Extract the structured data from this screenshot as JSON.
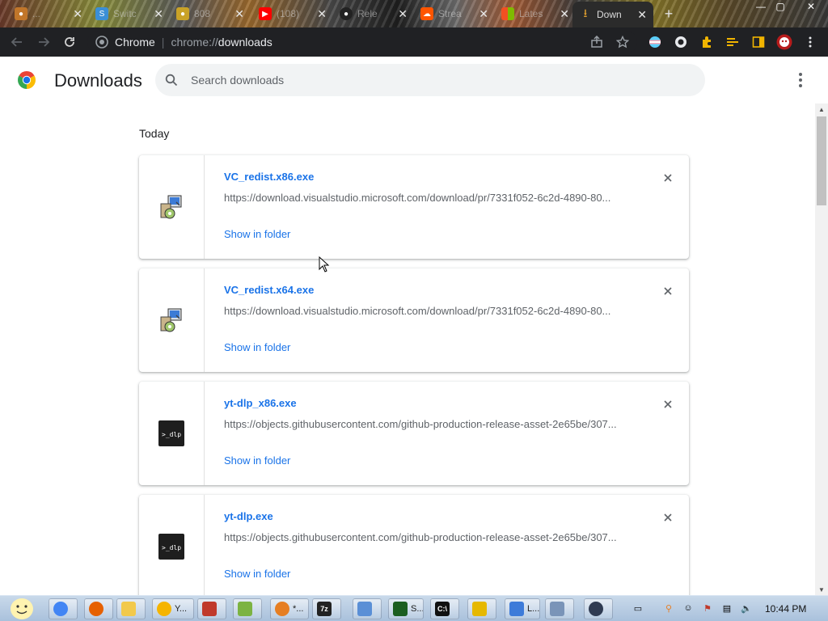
{
  "browser": {
    "tabs": [
      {
        "label": "...",
        "fav_color": "#c1762a"
      },
      {
        "label": "Switc",
        "fav_color": "#3b8fd6"
      },
      {
        "label": "808",
        "fav_color": "#c9a227"
      },
      {
        "label": "(108)",
        "fav_color": "#ff0000"
      },
      {
        "label": "Rele",
        "fav_color": "#222222"
      },
      {
        "label": "Strea",
        "fav_color": "#ff5500"
      },
      {
        "label": "Lates",
        "fav_color": "#0078d4"
      },
      {
        "label": "Down",
        "fav_color": "#e0a030",
        "active": true
      }
    ],
    "window_controls": {
      "minimize": "—",
      "maximize": "▢",
      "close": "✕"
    },
    "omnibox": {
      "site_label": "Chrome",
      "scheme": "chrome://",
      "path": "downloads"
    }
  },
  "page": {
    "title": "Downloads",
    "search_placeholder": "Search downloads",
    "section_label": "Today",
    "remove_label": "Remove from list",
    "items": [
      {
        "filename": "VC_redist.x86.exe",
        "url": "https://download.visualstudio.microsoft.com/download/pr/7331f052-6c2d-4890-80...",
        "action": "Show in folder",
        "icon": "installer-icon"
      },
      {
        "filename": "VC_redist.x64.exe",
        "url": "https://download.visualstudio.microsoft.com/download/pr/7331f052-6c2d-4890-80...",
        "action": "Show in folder",
        "icon": "installer-icon"
      },
      {
        "filename": "yt-dlp_x86.exe",
        "url": "https://objects.githubusercontent.com/github-production-release-asset-2e65be/307...",
        "action": "Show in folder",
        "icon": "yt-dlp-icon",
        "icon_text": ">_dlp"
      },
      {
        "filename": "yt-dlp.exe",
        "url": "https://objects.githubusercontent.com/github-production-release-asset-2e65be/307...",
        "action": "Show in folder",
        "icon": "yt-dlp-icon",
        "icon_text": ">_dlp"
      }
    ]
  },
  "taskbar": {
    "items": [
      {
        "label": "",
        "icon": "chrome-icon",
        "color": "#4285f4"
      },
      {
        "label": "",
        "icon": "firefox-icon",
        "color": "#e66000"
      },
      {
        "label": "",
        "icon": "folder-icon",
        "color": "#f2c94c"
      },
      {
        "label": "Y...",
        "icon": "emoji-icon",
        "color": "#f5b400"
      },
      {
        "label": "",
        "icon": "app-icon",
        "color": "#c0392b"
      },
      {
        "label": "",
        "icon": "notepad-icon",
        "color": "#7cb342"
      },
      {
        "label": "*...",
        "icon": "search-icon",
        "color": "#e67e22"
      },
      {
        "label": "",
        "icon": "7zip-icon",
        "color": "#222222",
        "text": "7z"
      },
      {
        "label": "",
        "icon": "installer-icon",
        "color": "#5a8fd6"
      },
      {
        "label": "S...",
        "icon": "monitor-icon",
        "color": "#1b5e20"
      },
      {
        "label": "",
        "icon": "terminal-icon",
        "color": "#111111",
        "text": "C:\\"
      },
      {
        "label": "",
        "icon": "shield-icon",
        "color": "#e6b800"
      },
      {
        "label": "L...",
        "icon": "installer-icon",
        "color": "#3d7bd9"
      },
      {
        "label": "",
        "icon": "window-icon",
        "color": "#7a94b8"
      },
      {
        "label": "",
        "icon": "globe-icon",
        "color": "#2f3b52"
      }
    ],
    "clock": "10:44 PM"
  }
}
